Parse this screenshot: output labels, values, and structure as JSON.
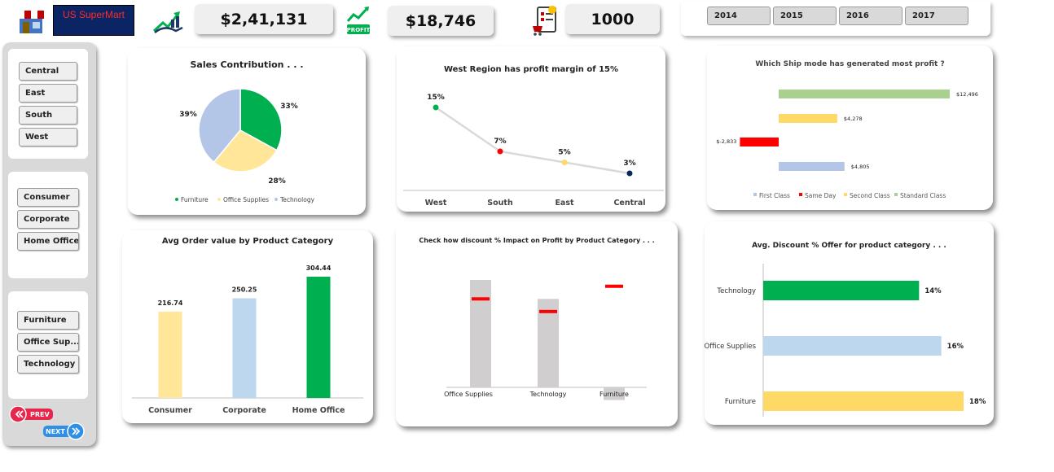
{
  "header": {
    "brand_text": "US SuperMart",
    "sales_kpi": "$2,41,131",
    "profit_kpi": "$18,746",
    "quantity_kpi": "1000",
    "profit_icon_text": "PROFIT",
    "years": [
      "2014",
      "2015",
      "2016",
      "2017"
    ]
  },
  "sidebar": {
    "regions": [
      "Central",
      "East",
      "South",
      "West"
    ],
    "segments": [
      "Consumer",
      "Corporate",
      "Home Office"
    ],
    "categories": [
      "Furniture",
      "Office Sup...",
      "Technology"
    ],
    "prev_label": "PREV",
    "next_label": "NEXT"
  },
  "colors": {
    "green": "#00b050",
    "yellow": "#ffe699",
    "blue": "#b4c6e7",
    "red": "#ff0000",
    "navy": "#0b2463"
  },
  "chart_data": [
    {
      "type": "pie",
      "title": "Sales Contribution . . .",
      "categories": [
        "Furniture",
        "Office Supplies",
        "Technology"
      ],
      "values": [
        33,
        28,
        39
      ],
      "value_labels": [
        "33%",
        "28%",
        "39%"
      ],
      "legend": "bottom"
    },
    {
      "type": "line",
      "title": "West Region has profit margin of  15%",
      "categories": [
        "West",
        "South",
        "East",
        "Central"
      ],
      "values": [
        15,
        7,
        5,
        3
      ],
      "value_labels": [
        "15%",
        "7%",
        "5%",
        "3%"
      ]
    },
    {
      "type": "bar",
      "title": "Which Ship mode has generated most profit ?",
      "orientation": "horizontal",
      "categories": [
        "First Class",
        "Same Day",
        "Second Class",
        "Standard Class"
      ],
      "values": [
        4805,
        -2833,
        4278,
        12496
      ],
      "value_labels": [
        "$4,805",
        "$-2,833",
        "$4,278",
        "$12,496"
      ],
      "legend": "bottom"
    },
    {
      "type": "bar",
      "title": "Avg Order value by Product Category",
      "categories": [
        "Consumer",
        "Corporate",
        "Home Office"
      ],
      "values": [
        216.74,
        250.25,
        304.44
      ],
      "value_labels": [
        "216.74",
        "250.25",
        "304.44"
      ]
    },
    {
      "type": "bar",
      "title": "Check how discount % Impact on Profit by Product Category . . .",
      "categories": [
        "Office Supplies",
        "Technology",
        "Furniture"
      ],
      "series": [
        {
          "values": [
            17,
            14,
            -2
          ]
        },
        {
          "values": [
            14,
            12,
            16
          ]
        }
      ]
    },
    {
      "type": "bar",
      "title": "Avg. Discount % Offer for product category . . .",
      "orientation": "horizontal",
      "categories": [
        "Technology",
        "Office Supplies",
        "Furniture"
      ],
      "values": [
        14,
        16,
        18
      ],
      "value_labels": [
        "14%",
        "16%",
        "18%"
      ]
    }
  ]
}
